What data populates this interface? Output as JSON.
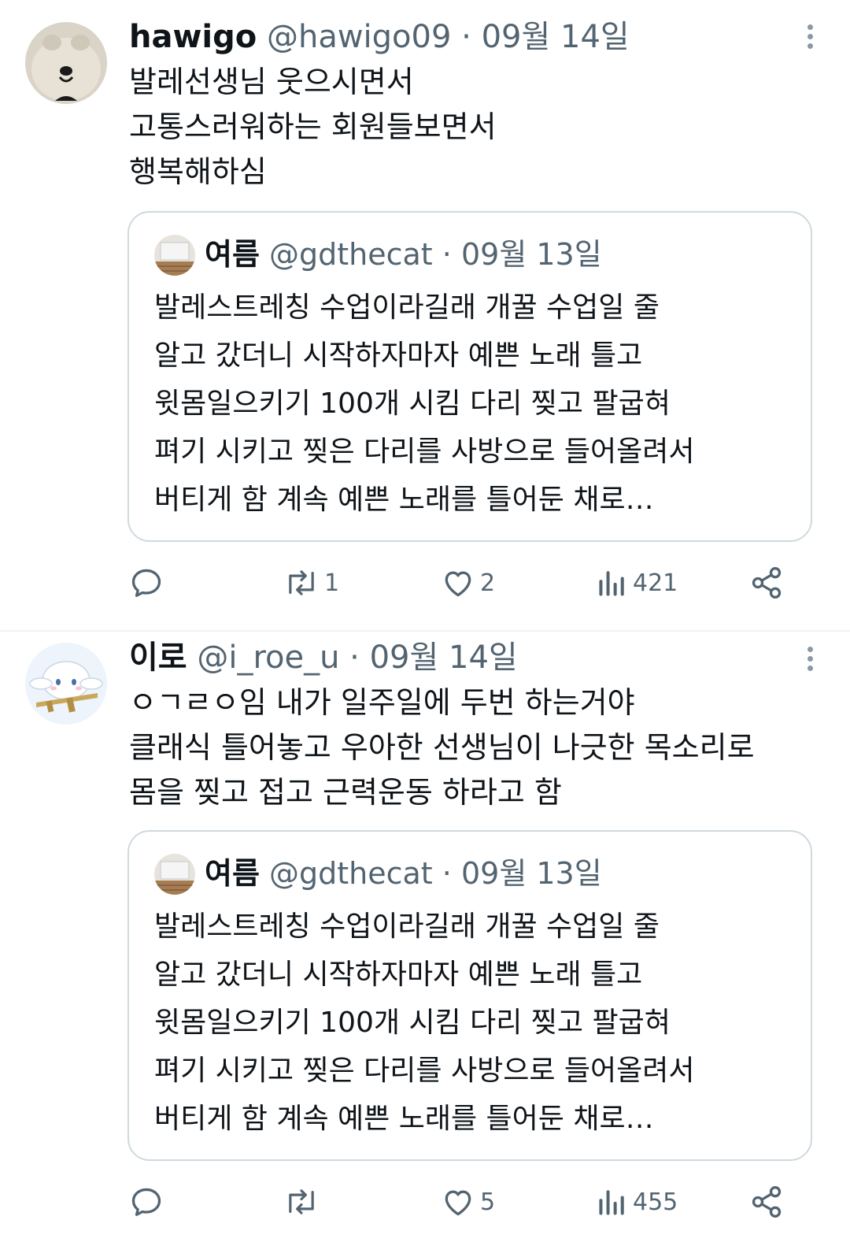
{
  "tweets": [
    {
      "display_name": "hawigo",
      "handle": "@hawigo09",
      "separator": "·",
      "date": "09월 14일",
      "avatar_icon": "bear-face-avatar",
      "text_lines": [
        "발레선생님 웃으시면서",
        "고통스러워하는 회원들보면서",
        "행복해하심"
      ],
      "quote": {
        "display_name": "여름",
        "handle": "@gdthecat",
        "separator": "·",
        "date": "09월 13일",
        "text_lines": [
          "발레스트레칭 수업이라길래 개꿀 수업일 줄",
          "알고 갔더니 시작하자마자 예쁜 노래 틀고",
          "윗몸일으키기 100개 시킴 다리 찢고 팔굽혀",
          "펴기 시키고 찢은 다리를 사방으로 들어올려서",
          "버티게 함 계속 예쁜 노래를 틀어둔 채로…"
        ]
      },
      "actions": {
        "reply_count": "",
        "retweet_count": "1",
        "like_count": "2",
        "view_count": "421"
      }
    },
    {
      "display_name": "이로",
      "handle": "@i_roe_u",
      "separator": "·",
      "date": "09월 14일",
      "avatar_icon": "cinnamoroll-avatar",
      "text_lines": [
        "ㅇㄱㄹㅇ임 내가 일주일에 두번 하는거야",
        "클래식 틀어놓고 우아한 선생님이 나긋한 목소리로",
        "몸을 찢고 접고 근력운동 하라고 함"
      ],
      "quote": {
        "display_name": "여름",
        "handle": "@gdthecat",
        "separator": "·",
        "date": "09월 13일",
        "text_lines": [
          "발레스트레칭 수업이라길래 개꿀 수업일 줄",
          "알고 갔더니 시작하자마자 예쁜 노래 틀고",
          "윗몸일으키기 100개 시킴 다리 찢고 팔굽혀",
          "펴기 시키고 찢은 다리를 사방으로 들어올려서",
          "버티게 함 계속 예쁜 노래를 틀어둔 채로…"
        ]
      },
      "actions": {
        "reply_count": "",
        "retweet_count": "",
        "like_count": "5",
        "view_count": "455"
      }
    }
  ],
  "colors": {
    "text_primary": "#0f1419",
    "text_secondary": "#536471",
    "border": "#cfd9de",
    "divider": "#eff3f4"
  }
}
